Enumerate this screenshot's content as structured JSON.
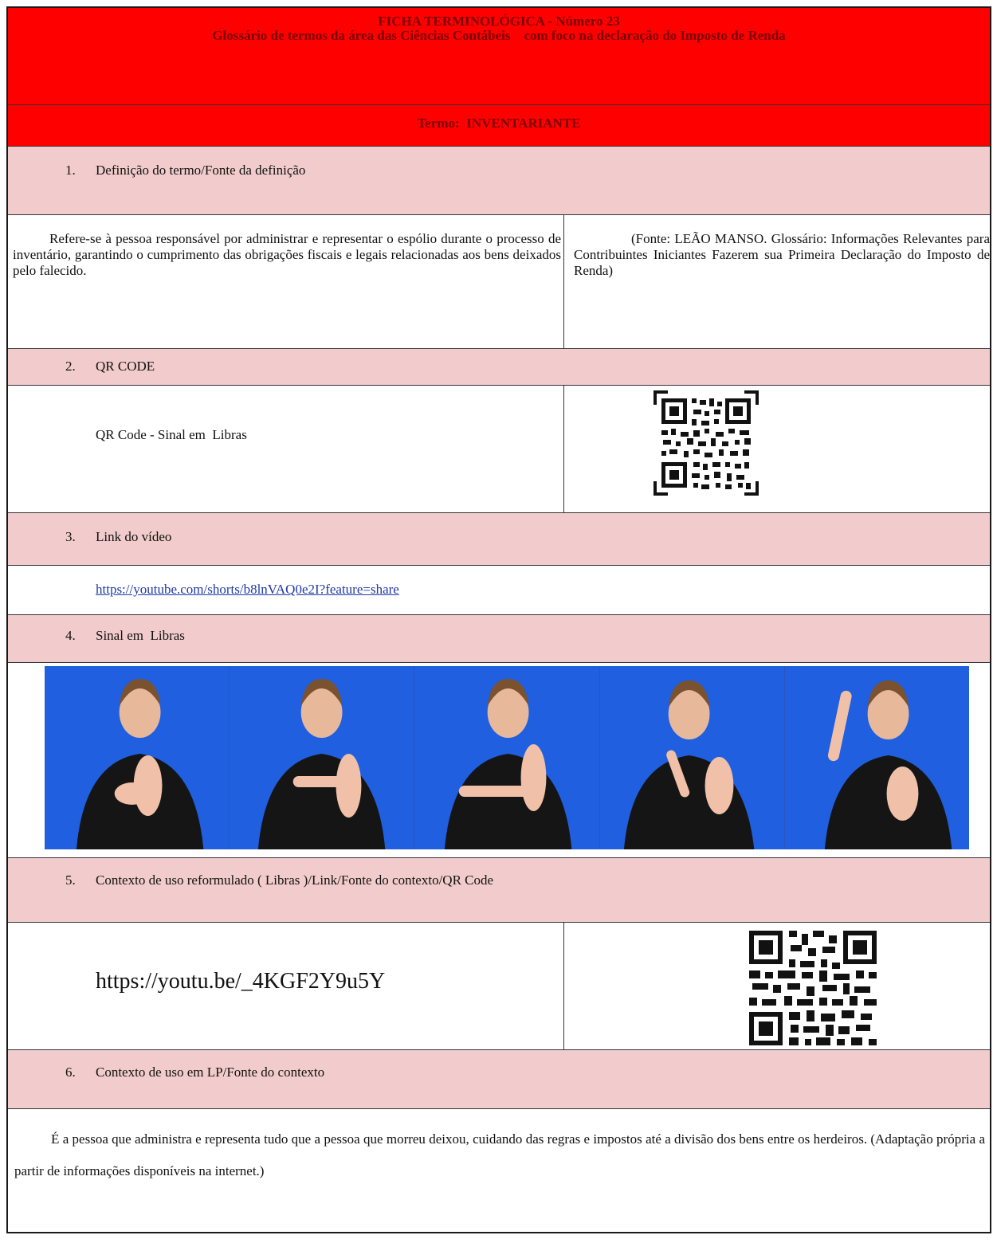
{
  "header": {
    "line1": "FICHA TERMINOLÓGICA - Número 23",
    "line2": "Glossário de termos da área das Ciências Contábeis    com foco na declaração do Imposto de Renda",
    "term": "Termo:  INVENTARIANTE"
  },
  "sections": [
    {
      "num": "1.",
      "label": "Definição do termo/Fonte da definição"
    },
    {
      "num": "2.",
      "label": "QR CODE"
    },
    {
      "num": "3.",
      "label": "Link do vídeo"
    },
    {
      "num": "4.",
      "label": "Sinal em  Libras"
    },
    {
      "num": "5.",
      "label": "Contexto de uso reformulado ( Libras )/Link/Fonte do contexto/QR Code"
    },
    {
      "num": "6.",
      "label": "Contexto de uso em LP/Fonte do contexto"
    }
  ],
  "definition": {
    "text": "Refere-se à pessoa responsável por administrar e representar o espólio durante o processo de inventário, garantindo o cumprimento das obrigações fiscais e legais relacionadas aos bens deixados pelo falecido.",
    "source": "(Fonte: LEÃO MANSO. Glossário: Informações Relevantes para Contribuintes Iniciantes Fazerem sua Primeira Declaração do Imposto de Renda)"
  },
  "qr_section": {
    "label": "QR Code - Sinal em  Libras"
  },
  "video_link": "https://youtube.com/shorts/b8lnVAQ0e2I?feature=share",
  "context_link": "https://youtu.be/_4KGF2Y9u5Y",
  "lp_context": "É a pessoa que administra e representa tudo que a pessoa que morreu deixou, cuidando das regras e impostos até a divisão dos bens entre os herdeiros. (Adaptação própria a partir de informações disponíveis na internet.)",
  "colors": {
    "header_red": "#ff0000",
    "section_pink": "#f2cccc",
    "photo_blue": "#1f5fe0"
  },
  "photos": [
    {
      "name": "sign-photo-1"
    },
    {
      "name": "sign-photo-2"
    },
    {
      "name": "sign-photo-3"
    },
    {
      "name": "sign-photo-4"
    },
    {
      "name": "sign-photo-5"
    }
  ]
}
